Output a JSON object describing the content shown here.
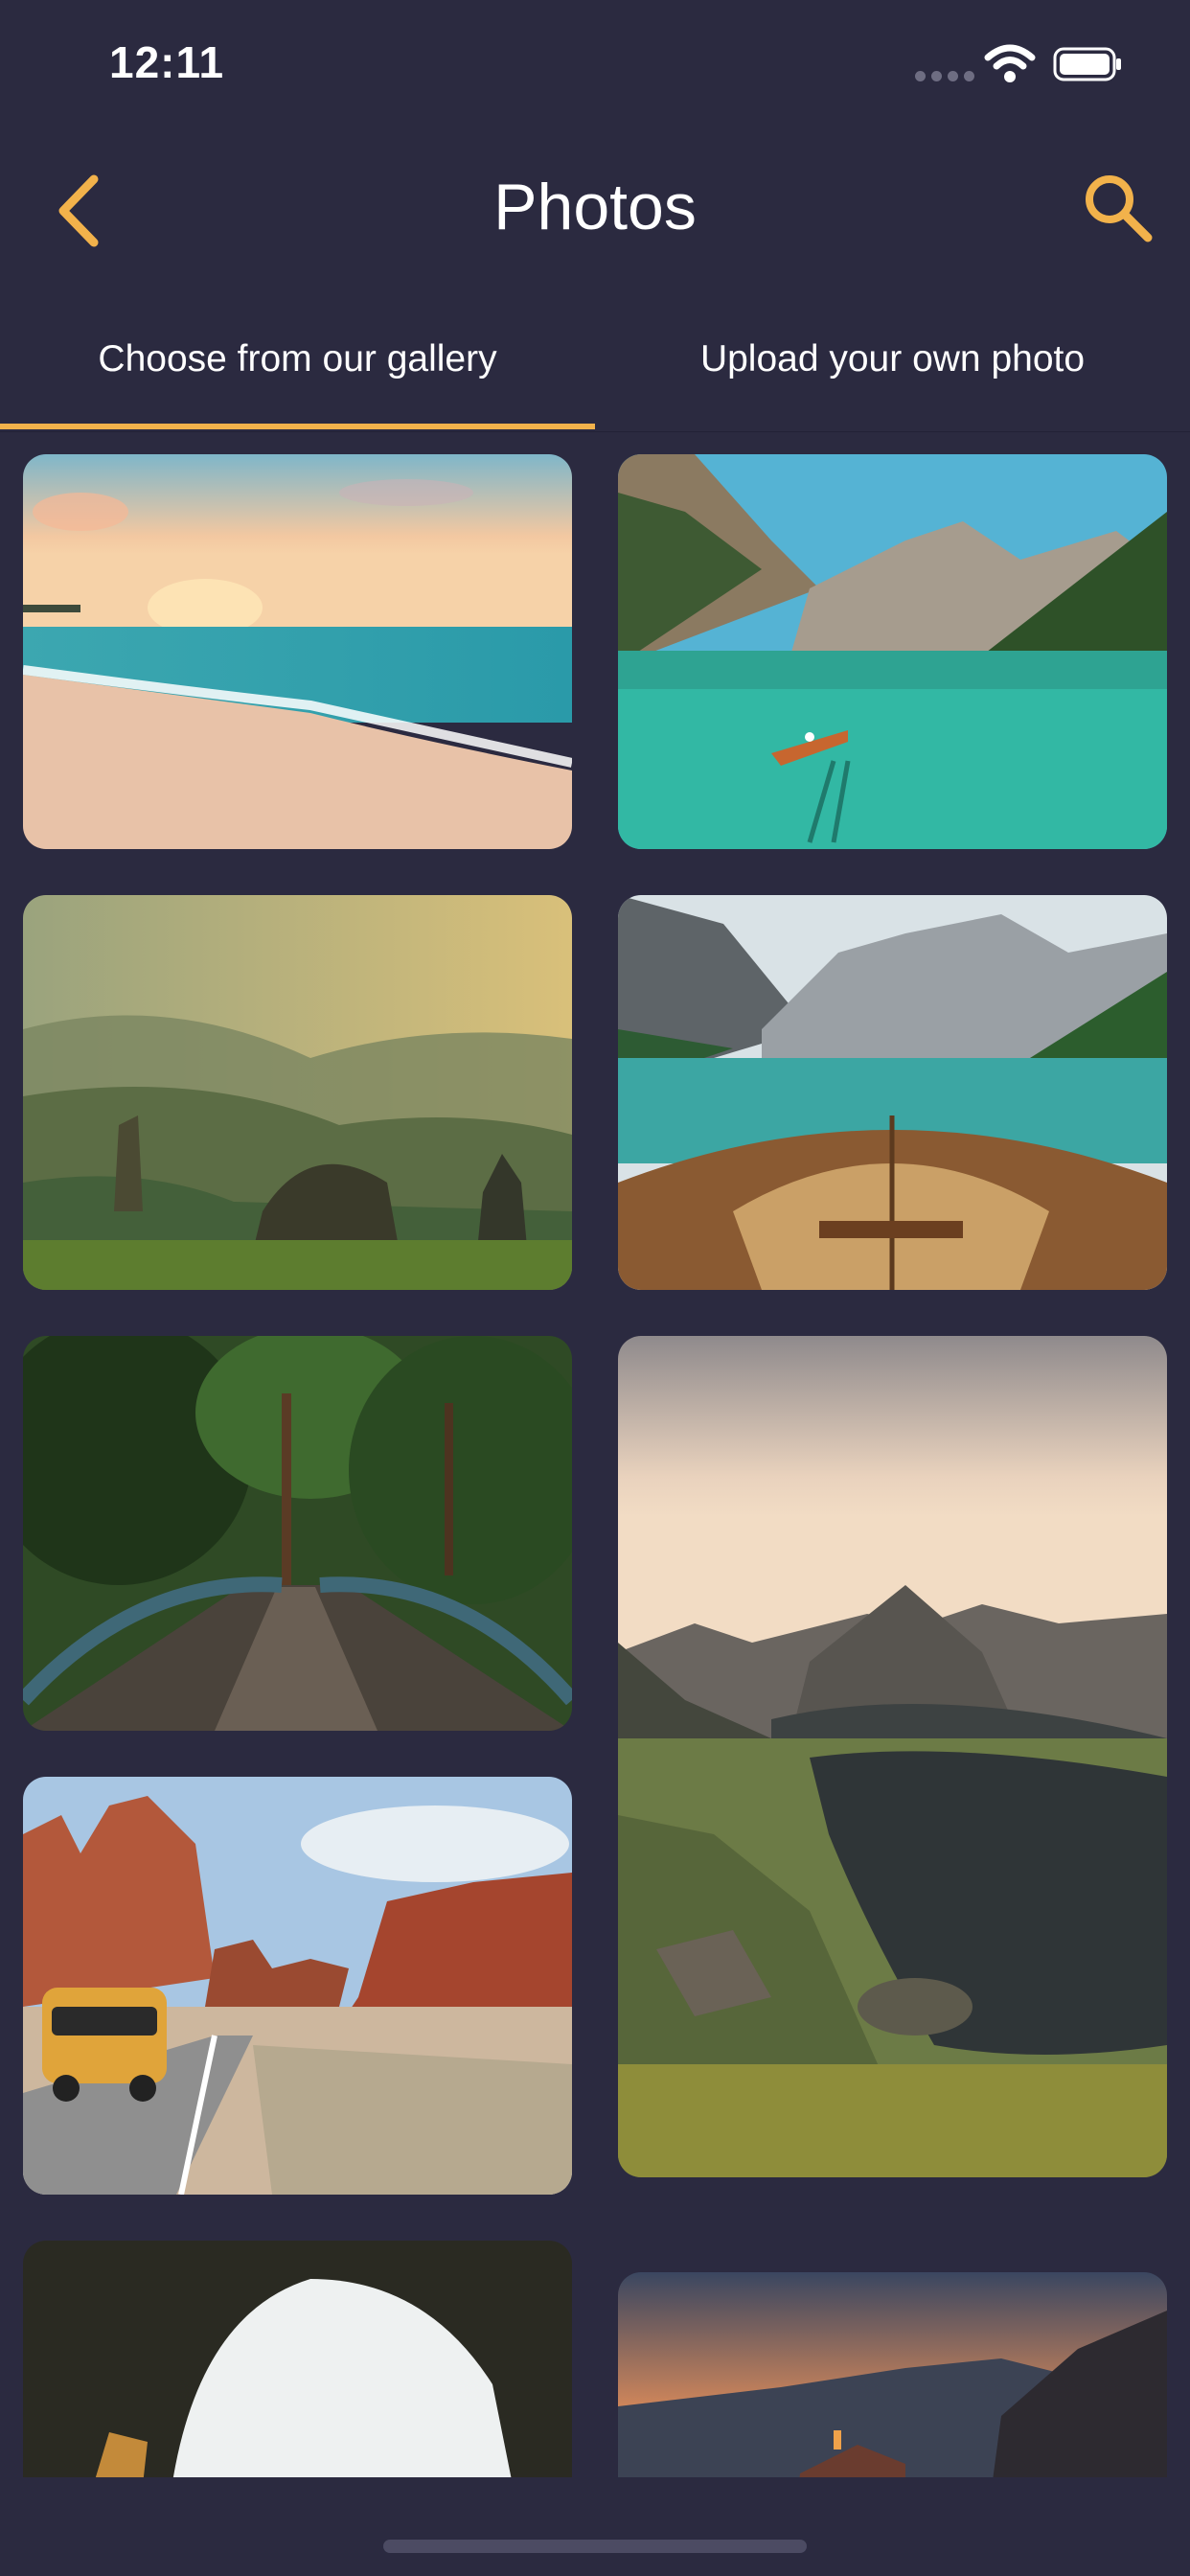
{
  "status_bar": {
    "time": "12:11"
  },
  "header": {
    "title": "Photos"
  },
  "tabs": [
    {
      "label": "Choose from our gallery",
      "active": true
    },
    {
      "label": "Upload your own photo",
      "active": false
    }
  ],
  "colors": {
    "background": "#2b2a40",
    "accent": "#f2b24b",
    "text": "#ffffff"
  },
  "icons": {
    "back": "chevron-left-icon",
    "search": "search-icon"
  }
}
